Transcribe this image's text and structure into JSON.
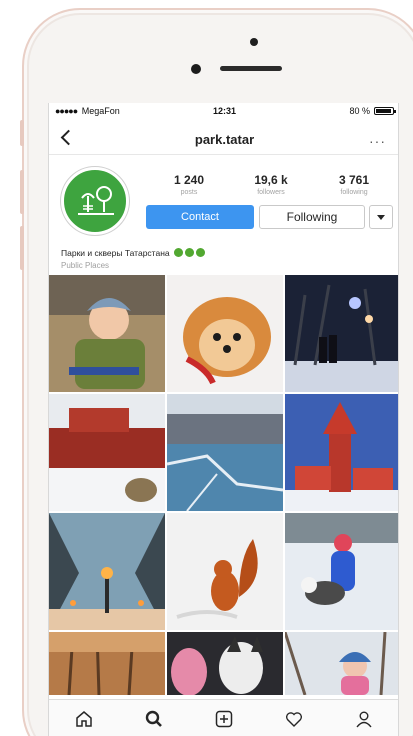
{
  "status_bar": {
    "carrier": "MegaFon",
    "time": "12:31",
    "battery": "80 %"
  },
  "nav": {
    "title": "park.tatar",
    "back_icon": "chevron-left-icon",
    "more_icon": "ellipsis-icon"
  },
  "profile": {
    "avatar_color": "#3ea43f",
    "stats": [
      {
        "value": "1 240",
        "label": "posts"
      },
      {
        "value": "19,6 k",
        "label": "followers"
      },
      {
        "value": "3 761",
        "label": "following"
      }
    ],
    "contact_label": "Contact",
    "following_label": "Following",
    "name": "Парки и скверы Татарстана",
    "category": "Public Places"
  },
  "colors": {
    "accent": "#3d95f0",
    "brand_green": "#3ea43f"
  },
  "grid": {
    "photos": [
      "photo-boy-in-hat",
      "photo-pomeranian-dog",
      "photo-night-winter-couple",
      "photo-red-fence-winter",
      "photo-frozen-river",
      "photo-red-playground-tower",
      "photo-snowy-lamp-alley",
      "photo-squirrel-in-snow",
      "photo-girl-with-husky",
      "photo-winter-trees-sunset",
      "photo-husky-child",
      "photo-child-in-snow"
    ]
  },
  "tab_bar": {
    "icons": [
      "home-icon",
      "search-icon",
      "add-post-icon",
      "heart-icon",
      "profile-icon"
    ]
  }
}
